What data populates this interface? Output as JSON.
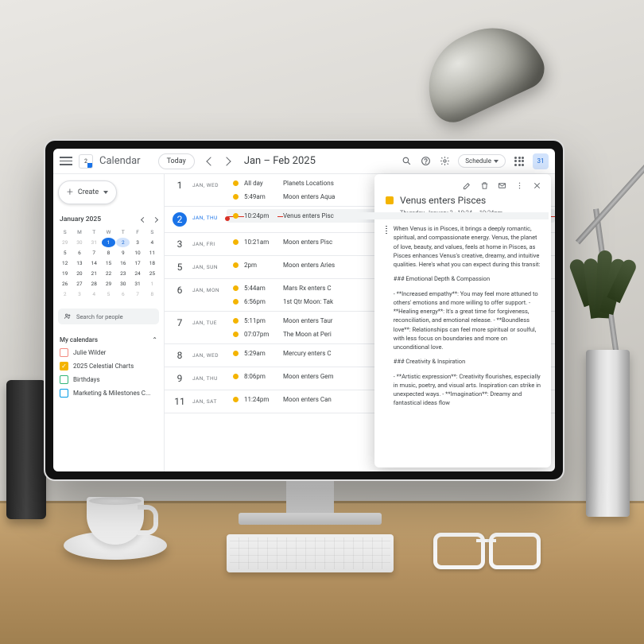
{
  "header": {
    "app_title": "Calendar",
    "logo_day": "2",
    "today_label": "Today",
    "date_range": "Jan – Feb 2025",
    "schedule_label": "Schedule",
    "today_badge": "31"
  },
  "sidebar": {
    "create_label": "Create",
    "mini_title": "January 2025",
    "dow": [
      "S",
      "M",
      "T",
      "W",
      "T",
      "F",
      "S"
    ],
    "weeks": [
      [
        {
          "n": "29",
          "o": true
        },
        {
          "n": "30",
          "o": true
        },
        {
          "n": "31",
          "o": true
        },
        {
          "n": "1",
          "today": true
        },
        {
          "n": "2",
          "sel": true
        },
        {
          "n": "3"
        },
        {
          "n": "4"
        }
      ],
      [
        {
          "n": "5"
        },
        {
          "n": "6"
        },
        {
          "n": "7"
        },
        {
          "n": "8"
        },
        {
          "n": "9"
        },
        {
          "n": "10"
        },
        {
          "n": "11"
        }
      ],
      [
        {
          "n": "12"
        },
        {
          "n": "13"
        },
        {
          "n": "14"
        },
        {
          "n": "15"
        },
        {
          "n": "16"
        },
        {
          "n": "17"
        },
        {
          "n": "18"
        }
      ],
      [
        {
          "n": "19"
        },
        {
          "n": "20"
        },
        {
          "n": "21"
        },
        {
          "n": "22"
        },
        {
          "n": "23"
        },
        {
          "n": "24"
        },
        {
          "n": "25"
        }
      ],
      [
        {
          "n": "26"
        },
        {
          "n": "27"
        },
        {
          "n": "28"
        },
        {
          "n": "29"
        },
        {
          "n": "30"
        },
        {
          "n": "31"
        },
        {
          "n": "1",
          "o": true
        }
      ],
      [
        {
          "n": "2",
          "o": true
        },
        {
          "n": "3",
          "o": true
        },
        {
          "n": "4",
          "o": true
        },
        {
          "n": "5",
          "o": true
        },
        {
          "n": "6",
          "o": true
        },
        {
          "n": "7",
          "o": true
        },
        {
          "n": "8",
          "o": true
        }
      ]
    ],
    "search_placeholder": "Search for people",
    "my_calendars_label": "My calendars",
    "calendars": [
      {
        "label": "Julie Wilder",
        "color": "#f28b82",
        "checked": false
      },
      {
        "label": "2025 Celestial Charts",
        "color": "#f4b400",
        "checked": true
      },
      {
        "label": "Birthdays",
        "color": "#33b679",
        "checked": false
      },
      {
        "label": "Marketing & Milestones C...",
        "color": "#039be5",
        "checked": false
      }
    ]
  },
  "agenda": [
    {
      "num": "1",
      "label": "JAN, WED",
      "events": [
        {
          "time": "All day",
          "title": "Planets Locations"
        },
        {
          "time": "5:49am",
          "title": "Moon enters Aqua"
        }
      ]
    },
    {
      "num": "2",
      "label": "JAN, THU",
      "active": true,
      "events": [
        {
          "time": "10:24pm",
          "title": "Venus enters Pisc",
          "hl": true,
          "now": true
        }
      ]
    },
    {
      "num": "3",
      "label": "JAN, FRI",
      "events": [
        {
          "time": "10:21am",
          "title": "Moon enters Pisc"
        }
      ]
    },
    {
      "num": "5",
      "label": "JAN, SUN",
      "events": [
        {
          "time": "2pm",
          "title": "Moon enters Aries"
        }
      ]
    },
    {
      "num": "6",
      "label": "JAN, MON",
      "events": [
        {
          "time": "5:44am",
          "title": "Mars Rx enters C"
        },
        {
          "time": "6:56pm",
          "title": "1st Qtr Moon: Tak"
        }
      ]
    },
    {
      "num": "7",
      "label": "JAN, TUE",
      "events": [
        {
          "time": "5:11pm",
          "title": "Moon enters Taur"
        },
        {
          "time": "07:07pm",
          "title": "The Moon at Peri"
        }
      ]
    },
    {
      "num": "8",
      "label": "JAN, WED",
      "events": [
        {
          "time": "5:29am",
          "title": "Mercury enters C"
        }
      ]
    },
    {
      "num": "9",
      "label": "JAN, THU",
      "events": [
        {
          "time": "8:06pm",
          "title": "Moon enters Gem"
        }
      ]
    },
    {
      "num": "11",
      "label": "JAN, SAT",
      "events": [
        {
          "time": "11:24pm",
          "title": "Moon enters Can"
        }
      ]
    }
  ],
  "popover": {
    "title": "Venus enters Pisces",
    "datetime": "Thursday, January 2  ·  10:24 – 10:24pm",
    "paragraphs": [
      "When Venus is in Pisces, it brings a deeply romantic, spiritual, and compassionate energy. Venus, the planet of love, beauty, and values, feels at home in Pisces, as Pisces enhances Venus's creative, dreamy, and intuitive qualities. Here's what you can expect during this transit:",
      "### Emotional Depth & Compassion",
      "- **Increased empathy**: You may feel more attuned to others' emotions and more willing to offer support.\n- **Healing energy**: It's a great time for forgiveness, reconciliation, and emotional release.\n- **Boundless love**: Relationships can feel more spiritual or soulful, with less focus on boundaries and more on unconditional love.",
      "### Creativity & Inspiration",
      "- **Artistic expression**: Creativity flourishes, especially in music, poetry, and visual arts. Inspiration can strike in unexpected ways.\n- **Imagination**: Dreamy and fantastical ideas flow"
    ]
  }
}
